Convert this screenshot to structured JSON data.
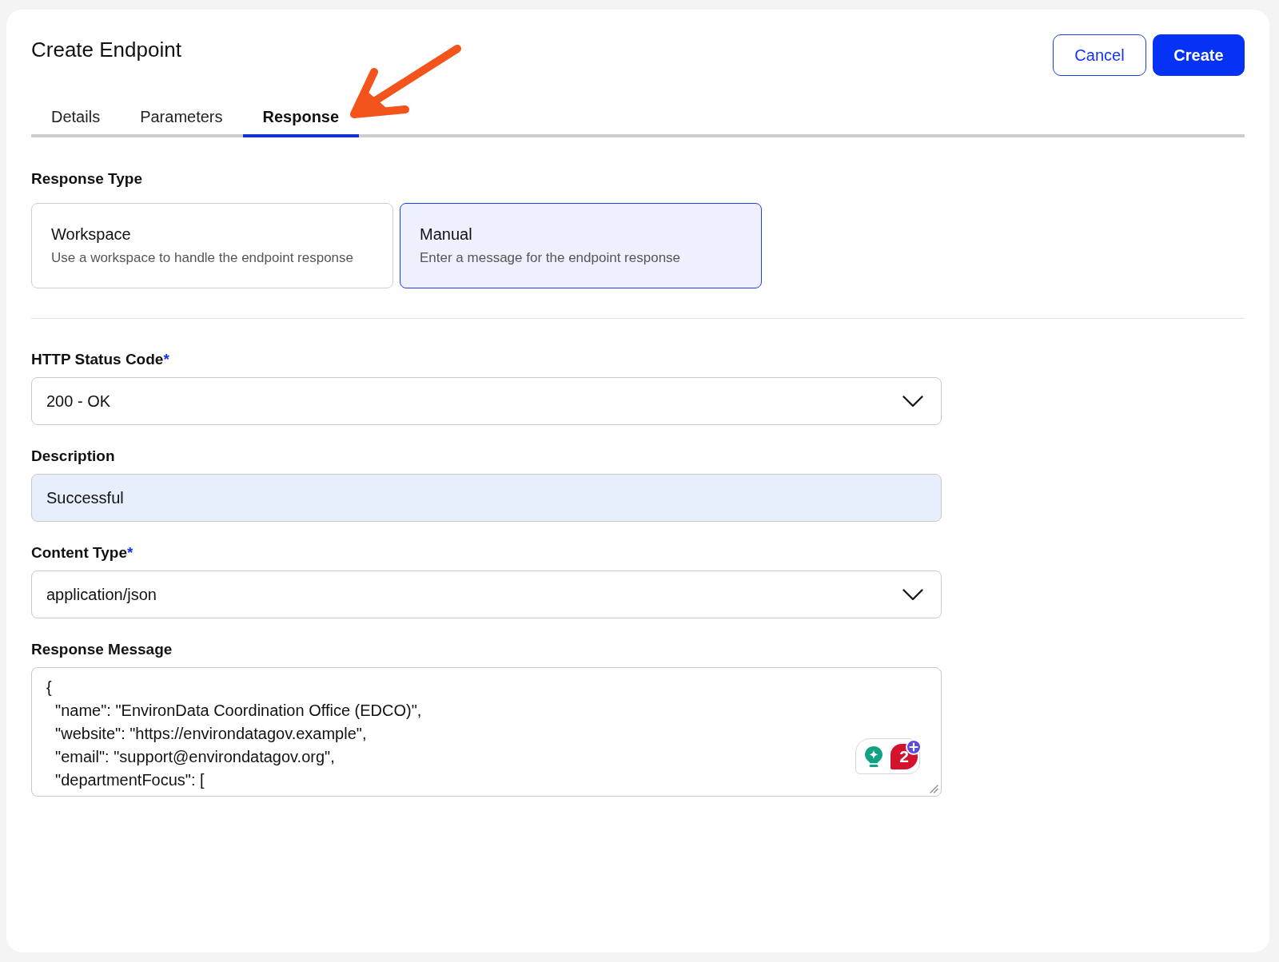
{
  "header": {
    "title": "Create Endpoint",
    "buttons": [
      {
        "label": "Cancel",
        "kind": "secondary"
      },
      {
        "label": "Create",
        "kind": "primary"
      }
    ]
  },
  "tabs": [
    {
      "label": "Details",
      "selected": false
    },
    {
      "label": "Parameters",
      "selected": false
    },
    {
      "label": "Response",
      "selected": true
    }
  ],
  "response_type": {
    "label": "Response Type",
    "options": [
      {
        "title": "Workspace",
        "description": "Use a workspace to handle the endpoint response",
        "selected": false
      },
      {
        "title": "Manual",
        "description": "Enter a message for the endpoint response",
        "selected": true
      }
    ]
  },
  "fields": [
    {
      "kind": "select",
      "label": "HTTP Status Code",
      "required_mark": "*",
      "value": "200 - OK",
      "autofilled": false
    },
    {
      "kind": "input",
      "label": "Description",
      "value": "Successful",
      "autofilled": true
    },
    {
      "kind": "select",
      "label": "Content Type",
      "required_mark": "*",
      "value": "application/json",
      "autofilled": false
    },
    {
      "kind": "textarea",
      "label": "Response Message",
      "value": "{\n  \"name\": \"EnvironData Coordination Office (EDCO)\",\n  \"website\": \"https://environdatagov.example\",\n  \"email\": \"support@environdatagov.org\",\n  \"departmentFocus\": [",
      "autofilled": false,
      "assistant": {
        "count": "2"
      }
    }
  ]
}
